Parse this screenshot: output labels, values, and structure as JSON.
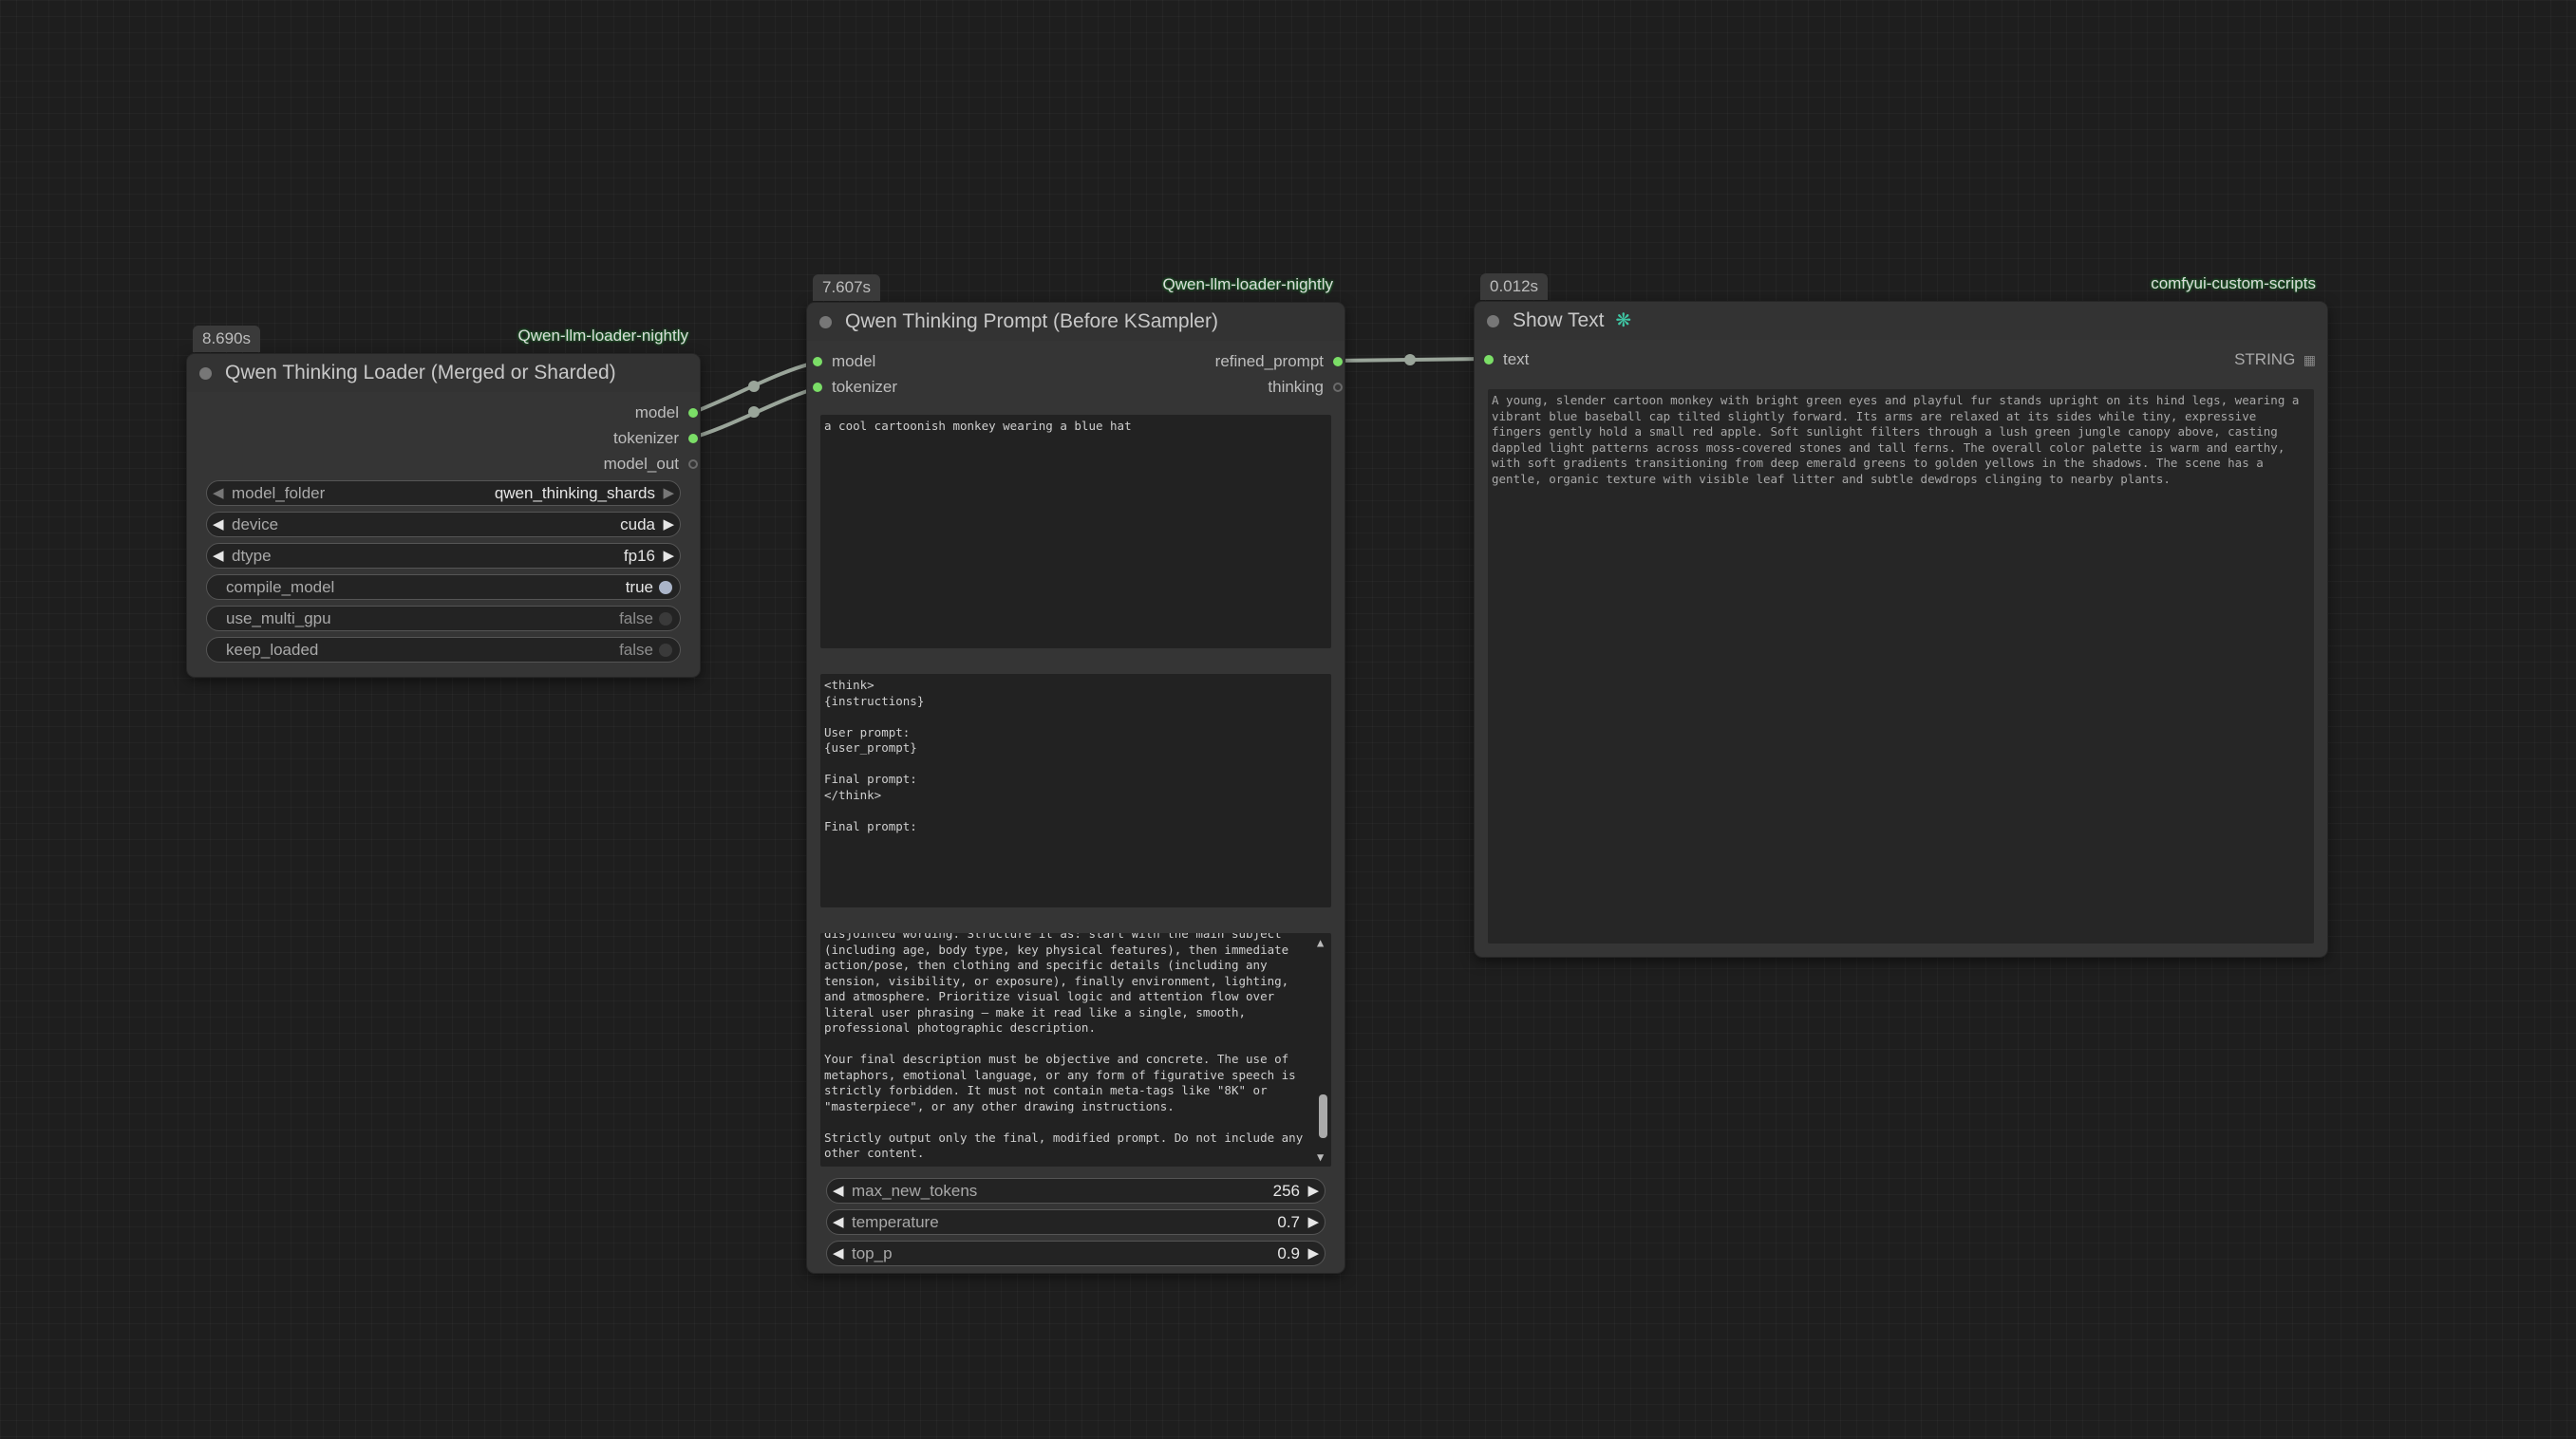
{
  "loader_node": {
    "timing": "8.690s",
    "source": "Qwen-llm-loader-nightly",
    "title": "Qwen Thinking Loader (Merged or Sharded)",
    "outputs": [
      "model",
      "tokenizer",
      "model_out"
    ],
    "widgets": {
      "model_folder": {
        "label": "model_folder",
        "value": "qwen_thinking_shards"
      },
      "device": {
        "label": "device",
        "value": "cuda"
      },
      "dtype": {
        "label": "dtype",
        "value": "fp16"
      },
      "compile_model": {
        "label": "compile_model",
        "value": "true"
      },
      "use_multi_gpu": {
        "label": "use_multi_gpu",
        "value": "false"
      },
      "keep_loaded": {
        "label": "keep_loaded",
        "value": "false"
      }
    }
  },
  "prompt_node": {
    "timing": "7.607s",
    "source": "Qwen-llm-loader-nightly",
    "title": "Qwen Thinking Prompt (Before KSampler)",
    "inputs": [
      "model",
      "tokenizer"
    ],
    "outputs": [
      "refined_prompt",
      "thinking"
    ],
    "user_prompt": "a cool cartoonish monkey wearing a blue hat",
    "template": "<think>\n{instructions}\n\nUser prompt:\n{user_prompt}\n\nFinal prompt:\n</think>\n\nFinal prompt:",
    "instructions_visible": "disjointed wording. Structure it as: start with the main subject\n(including age, body type, key physical features), then immediate\naction/pose, then clothing and specific details (including any\ntension, visibility, or exposure), finally environment, lighting,\nand atmosphere. Prioritize visual logic and attention flow over\nliteral user phrasing — make it read like a single, smooth,\nprofessional photographic description.\n\nYour final description must be objective and concrete. The use of\nmetaphors, emotional language, or any form of figurative speech is\nstrictly forbidden. It must not contain meta-tags like \"8K\" or\n\"masterpiece\", or any other drawing instructions.\n\nStrictly output only the final, modified prompt. Do not include any\nother content.",
    "widgets": {
      "max_new_tokens": {
        "label": "max_new_tokens",
        "value": "256"
      },
      "temperature": {
        "label": "temperature",
        "value": "0.7"
      },
      "top_p": {
        "label": "top_p",
        "value": "0.9"
      }
    }
  },
  "show_text_node": {
    "timing": "0.012s",
    "source": "comfyui-custom-scripts",
    "title": "Show Text",
    "title_icon": "link-icon",
    "input": "text",
    "output_type": "STRING",
    "text": "A young, slender cartoon monkey with bright green eyes and playful fur stands upright on its hind legs, wearing a\nvibrant blue baseball cap tilted slightly forward. Its arms are relaxed at its sides while tiny, expressive\nfingers gently hold a small red apple. Soft sunlight filters through a lush green jungle canopy above, casting\ndappled light patterns across moss-covered stones and tall ferns. The overall color palette is warm and earthy,\nwith soft gradients transitioning from deep emerald greens to golden yellows in the shadows. The scene has a\ngentle, organic texture with visible leaf litter and subtle dewdrops clinging to nearby plants."
  },
  "colors": {
    "canvas": "#1e1e1e",
    "node_body": "#353535",
    "slot_connected": "#7bde67",
    "link": "#9aa59a"
  }
}
